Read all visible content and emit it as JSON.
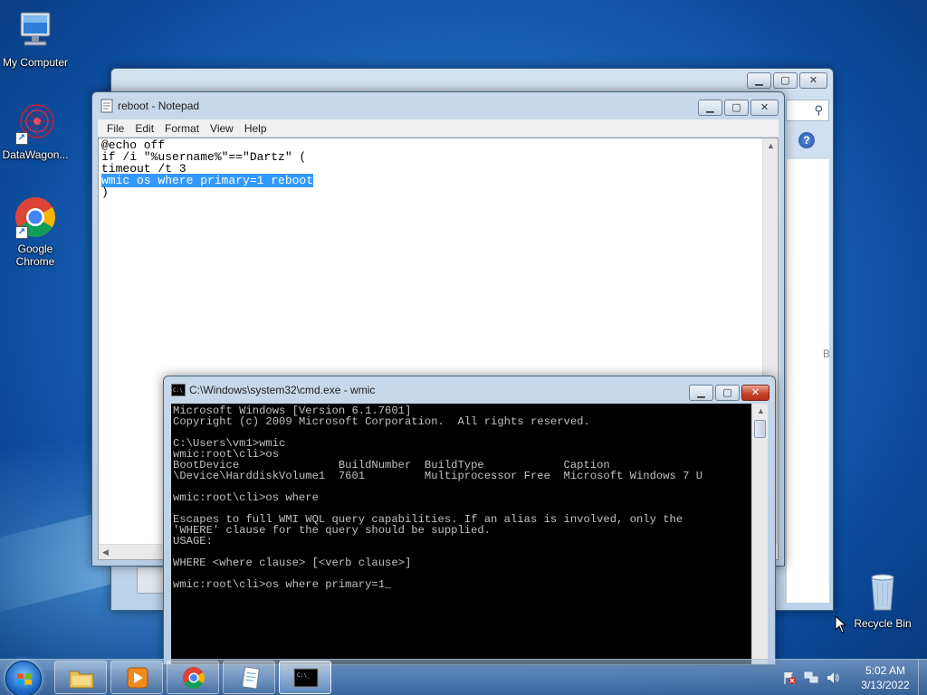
{
  "desktop": {
    "icons": [
      {
        "label": "My Computer"
      },
      {
        "label": "DataWagon..."
      },
      {
        "label": "Google Chrome"
      },
      {
        "label": "Recycle Bin"
      }
    ]
  },
  "notepad": {
    "title": "reboot - Notepad",
    "menu": [
      "File",
      "Edit",
      "Format",
      "View",
      "Help"
    ],
    "lines": [
      "@echo off",
      "if /i \"%username%\"==\"Dartz\" (",
      "timeout /t 3",
      "wmic os where primary=1 reboot",
      ")"
    ],
    "selected_line": 3
  },
  "background_window": {
    "partial_text": "B"
  },
  "cmd": {
    "title": "C:\\Windows\\system32\\cmd.exe - wmic",
    "lines": [
      "Microsoft Windows [Version 6.1.7601]",
      "Copyright (c) 2009 Microsoft Corporation.  All rights reserved.",
      "",
      "C:\\Users\\vm1>wmic",
      "wmic:root\\cli>os",
      "BootDevice               BuildNumber  BuildType            Caption",
      "\\Device\\HarddiskVolume1  7601         Multiprocessor Free  Microsoft Windows 7 U",
      "",
      "wmic:root\\cli>os where",
      "",
      "Escapes to full WMI WQL query capabilities. If an alias is involved, only the",
      "'WHERE' clause for the query should be supplied.",
      "USAGE:",
      "",
      "WHERE <where clause> [<verb clause>]",
      "",
      "wmic:root\\cli>os where primary=1_"
    ]
  },
  "taskbar": {
    "buttons": [
      "explorer",
      "media-player",
      "chrome",
      "notepad",
      "cmd"
    ],
    "active": "cmd",
    "clock_time": "5:02 AM",
    "clock_date": "3/13/2022"
  },
  "colors": {
    "selection": "#3399ff",
    "console_bg": "#000000",
    "console_fg": "#c0c0c0",
    "close_red": "#c7462c"
  }
}
